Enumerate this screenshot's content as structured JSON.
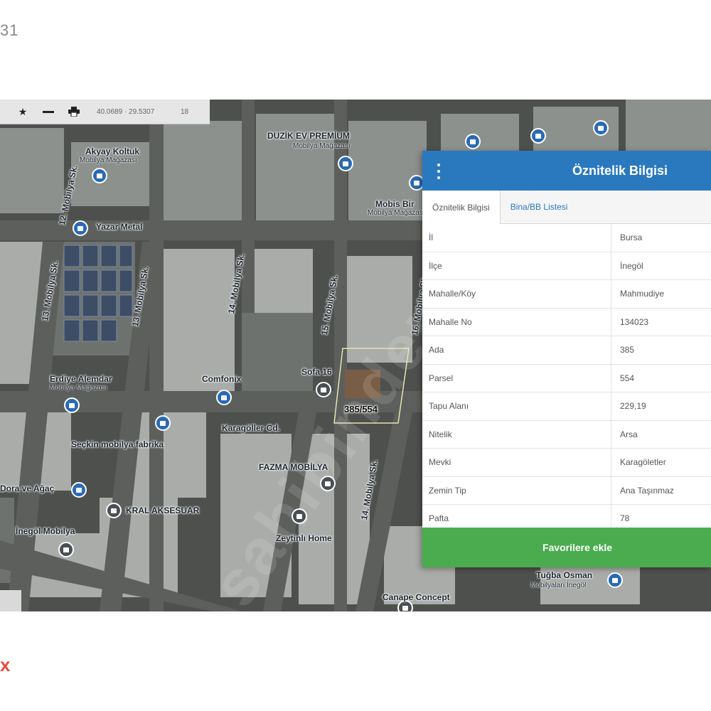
{
  "page": {
    "corner_number": "31",
    "corner_mark": "x"
  },
  "toolbar": {
    "star_icon": "star-icon",
    "measure_icon": "ruler-icon",
    "print_icon": "printer-icon",
    "coords": "40.0689 · 29.5307",
    "zoom": "18"
  },
  "map": {
    "parcel_label": "385/554",
    "watermark": "sahibinden",
    "places": [
      {
        "name": "Akyay Koltuk",
        "sub": "Mobilya Mağazası"
      },
      {
        "name": "DUZİK EV PREMİUM",
        "sub": "Mobilya Mağazası"
      },
      {
        "name": "Yazar Metal",
        "sub": ""
      },
      {
        "name": "Mobis Bir",
        "sub": "Mobilya Mağazası"
      },
      {
        "name": "Erdiye Alemdar",
        "sub": "Mobilya Mağazası"
      },
      {
        "name": "Comfonix",
        "sub": ""
      },
      {
        "name": "Sofa 16",
        "sub": ""
      },
      {
        "name": "Seçkin mobilya fabrika",
        "sub": ""
      },
      {
        "name": "FAZMA MOBİLYA",
        "sub": ""
      },
      {
        "name": "Karagöller Cd.",
        "sub": ""
      },
      {
        "name": "KRAL AKSESUAR",
        "sub": ""
      },
      {
        "name": "İnegöl Mobilya",
        "sub": ""
      },
      {
        "name": "Zeytinlı Home",
        "sub": ""
      },
      {
        "name": "Canape Concept",
        "sub": ""
      },
      {
        "name": "Tuğba Osman",
        "sub": "Mobilyaları İnegöl"
      },
      {
        "name": "Dora ve Ağaç",
        "sub": ""
      }
    ],
    "streets": [
      "12. Mobilya Sk.",
      "13. Mobilya Sk.",
      "13. Mobilya Sk.",
      "14. Mobilya Sk.",
      "15. Mobilya Sk.",
      "16. Mobilya Sk.",
      "14. Mobilya Sk."
    ]
  },
  "panel": {
    "title": "Öznitelik Bilgisi",
    "menu_icon": "kebab-menu-icon",
    "tabs": [
      {
        "label": "Öznitelik Bilgisi",
        "active": true
      },
      {
        "label": "Bina/BB Listesi",
        "active": false
      }
    ],
    "rows": [
      {
        "key": "İl",
        "value": "Bursa"
      },
      {
        "key": "İlçe",
        "value": "İnegöl"
      },
      {
        "key": "Mahalle/Köy",
        "value": "Mahmudiye"
      },
      {
        "key": "Mahalle No",
        "value": "134023"
      },
      {
        "key": "Ada",
        "value": "385"
      },
      {
        "key": "Parsel",
        "value": "554"
      },
      {
        "key": "Tapu Alanı",
        "value": "229,19"
      },
      {
        "key": "Nitelik",
        "value": "Arsa"
      },
      {
        "key": "Mevki",
        "value": "Karagöletler"
      },
      {
        "key": "Zemin Tip",
        "value": "Ana Taşınmaz"
      },
      {
        "key": "Pafta",
        "value": "78"
      }
    ],
    "favorite_button": "Favorilere ekle",
    "colors": {
      "header": "#2a79bf",
      "button": "#4aac4e"
    }
  }
}
